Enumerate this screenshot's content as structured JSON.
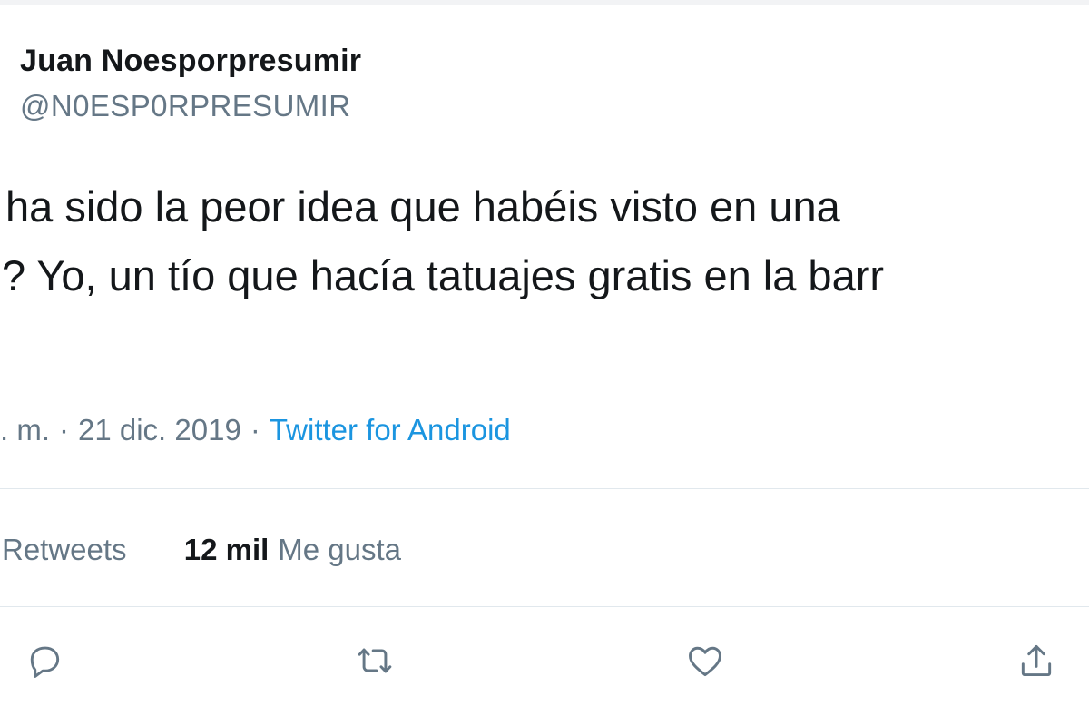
{
  "tweet": {
    "author_name": "Juan Noesporpresumir",
    "author_handle": "@N0ESP0RPRESUMIR",
    "text_lines": [
      "ha sido la peor idea que habéis visto en una",
      "? Yo, un tío que hacía tatuajes gratis en la barr",
      ""
    ],
    "time_fragment": ". m.",
    "separator": "·",
    "date": "21 dic. 2019",
    "source": "Twitter for Android"
  },
  "stats": {
    "retweets_label": "Retweets",
    "likes_value": "12 mil",
    "likes_label": "Me gusta"
  },
  "actions": [
    {
      "name": "reply",
      "icon": "reply-icon"
    },
    {
      "name": "retweet",
      "icon": "retweet-icon"
    },
    {
      "name": "like",
      "icon": "heart-icon"
    },
    {
      "name": "share",
      "icon": "share-icon"
    }
  ],
  "colors": {
    "text_primary": "#14171a",
    "text_secondary": "#657786",
    "link": "#1b95e0",
    "divider": "#e1e8ed"
  }
}
